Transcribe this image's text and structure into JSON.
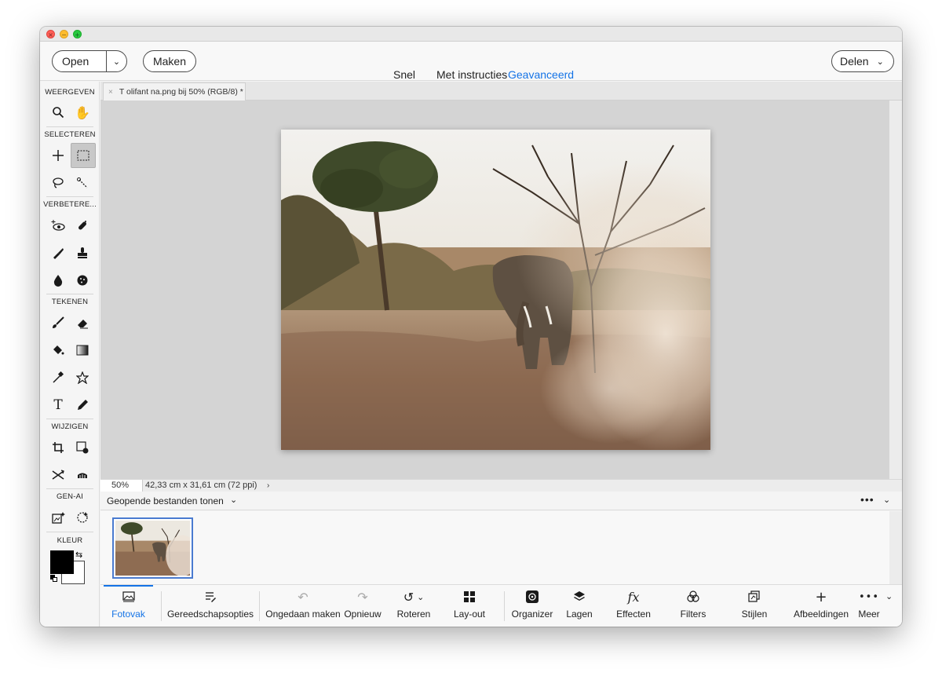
{
  "window": {
    "controls": [
      "close",
      "minimize",
      "maximize"
    ]
  },
  "topbar": {
    "open_label": "Open",
    "make_label": "Maken",
    "modes": [
      "Snel",
      "Met instructies",
      "Geavanceerd"
    ],
    "active_mode": "Geavanceerd",
    "share_label": "Delen",
    "accent": "#1473e6"
  },
  "toolbox": {
    "sections": {
      "view": "WEERGEVEN",
      "select": "SELECTEREN",
      "enhance": "VERBETERE...",
      "draw": "TEKENEN",
      "modify": "WIJZIGEN",
      "genai": "GEN-AI",
      "color": "KLEUR"
    },
    "foreground_color": "#000000",
    "background_color": "#ffffff"
  },
  "document": {
    "tab_title": "T olifant na.png bij 50% (RGB/8) *",
    "zoom": "50%",
    "dimensions": "42,33 cm x 31,61 cm (72 ppi)"
  },
  "bin": {
    "dropdown_label": "Geopende bestanden tonen"
  },
  "bottombar": {
    "items": [
      "Fotovak",
      "Gereedschapsopties",
      "Ongedaan maken",
      "Opnieuw",
      "Roteren",
      "Lay-out",
      "Organizer",
      "Lagen",
      "Effecten",
      "Filters",
      "Stijlen",
      "Afbeeldingen",
      "Meer"
    ],
    "active": "Fotovak"
  }
}
